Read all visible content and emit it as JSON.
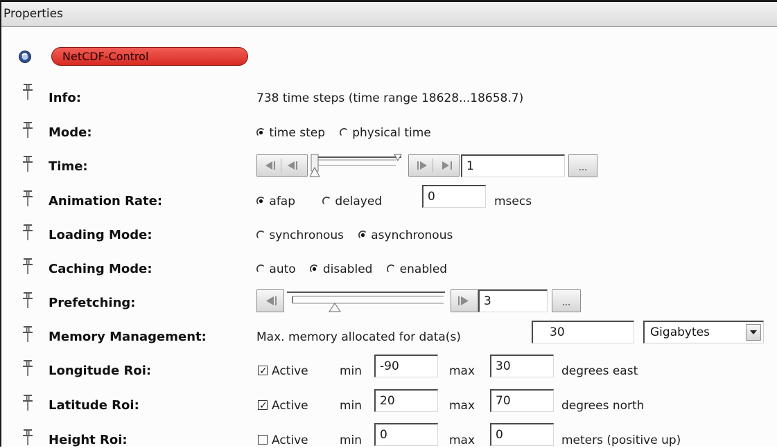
{
  "panel": {
    "title": "Properties"
  },
  "module": {
    "name": "NetCDF-Control"
  },
  "info": {
    "label": "Info:",
    "value": "738 time steps (time range 18628...18658.7)"
  },
  "mode": {
    "label": "Mode:",
    "opt1": "time step",
    "opt2": "physical time",
    "selected": "time step"
  },
  "time": {
    "label": "Time:",
    "value": "1",
    "browse": "..."
  },
  "animation": {
    "label": "Animation Rate:",
    "opt1": "afap",
    "opt2": "delayed",
    "delay_value": "0",
    "unit": "msecs",
    "selected": "afap"
  },
  "loading": {
    "label": "Loading Mode:",
    "opt1": "synchronous",
    "opt2": "asynchronous",
    "selected": "asynchronous"
  },
  "caching": {
    "label": "Caching Mode:",
    "opt1": "auto",
    "opt2": "disabled",
    "opt3": "enabled",
    "selected": "disabled"
  },
  "prefetching": {
    "label": "Prefetching:",
    "value": "3",
    "browse": "..."
  },
  "memory": {
    "label": "Memory Management:",
    "prefix": "Max. memory allocated for data(s)",
    "value": "30",
    "unit": "Gigabytes"
  },
  "lon_roi": {
    "label": "Longitude Roi:",
    "active_label": "Active",
    "min_label": "min",
    "min": "-90",
    "max_label": "max",
    "max": "30",
    "unit": "degrees east",
    "active": true
  },
  "lat_roi": {
    "label": "Latitude Roi:",
    "active_label": "Active",
    "min_label": "min",
    "min": "20",
    "max_label": "max",
    "max": "70",
    "unit": "degrees north",
    "active": true
  },
  "height_roi": {
    "label": "Height Roi:",
    "active_label": "Active",
    "min_label": "min",
    "min": "0",
    "max_label": "max",
    "max": "0",
    "unit": "meters (positive up)",
    "active": false
  }
}
